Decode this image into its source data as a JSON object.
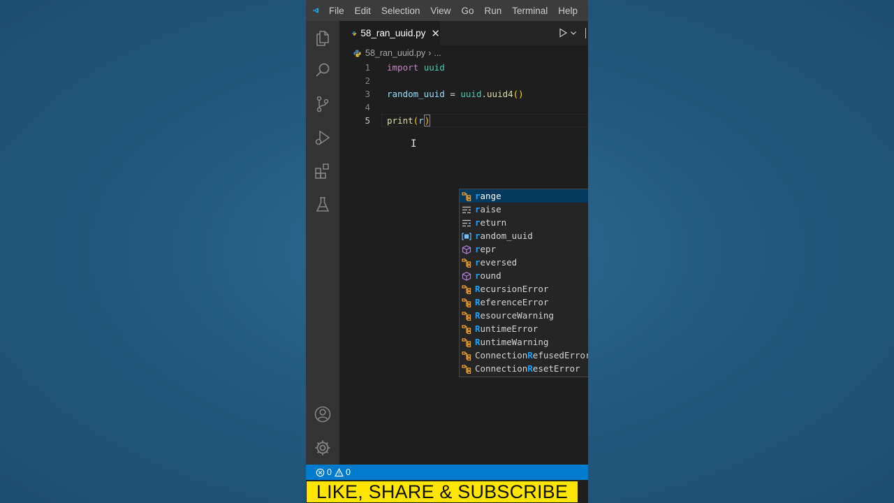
{
  "menu": [
    "File",
    "Edit",
    "Selection",
    "View",
    "Go",
    "Run",
    "Terminal",
    "Help"
  ],
  "tab": {
    "filename": "58_ran_uuid.py",
    "close": "✕"
  },
  "breadcrumb": {
    "file": "58_ran_uuid.py",
    "more": "..."
  },
  "editor": {
    "line_numbers": [
      "1",
      "2",
      "3",
      "4",
      "5"
    ],
    "line1": {
      "kw": "import",
      "mod": "uuid"
    },
    "line3": {
      "var": "random_uuid",
      "op": " = ",
      "mod": "uuid",
      "dot": ".",
      "fn": "uuid4",
      "args": "()"
    },
    "line5": {
      "fn": "print",
      "open": "(",
      "typed": "r",
      "close": ")"
    }
  },
  "suggestions": [
    {
      "kind": "class",
      "match": "r",
      "rest": "ange",
      "pre": ""
    },
    {
      "kind": "keyword",
      "match": "r",
      "rest": "aise",
      "pre": ""
    },
    {
      "kind": "keyword",
      "match": "r",
      "rest": "eturn",
      "pre": ""
    },
    {
      "kind": "variable",
      "match": "r",
      "rest": "andom_uuid",
      "pre": ""
    },
    {
      "kind": "function",
      "match": "r",
      "rest": "epr",
      "pre": ""
    },
    {
      "kind": "class",
      "match": "r",
      "rest": "eversed",
      "pre": ""
    },
    {
      "kind": "function",
      "match": "r",
      "rest": "ound",
      "pre": ""
    },
    {
      "kind": "class",
      "match": "R",
      "rest": "ecursionError",
      "pre": ""
    },
    {
      "kind": "class",
      "match": "R",
      "rest": "eferenceError",
      "pre": ""
    },
    {
      "kind": "class",
      "match": "R",
      "rest": "esourceWarning",
      "pre": ""
    },
    {
      "kind": "class",
      "match": "R",
      "rest": "untimeError",
      "pre": ""
    },
    {
      "kind": "class",
      "match": "R",
      "rest": "untimeWarning",
      "pre": ""
    },
    {
      "kind": "class",
      "match": "R",
      "rest": "efusedError",
      "pre": "Connection"
    },
    {
      "kind": "class",
      "match": "R",
      "rest": "esetError",
      "pre": "Connection"
    }
  ],
  "status": {
    "errors": "0",
    "warnings": "0"
  },
  "banner": "LIKE, SHARE & SUBSCRIBE",
  "colors": {
    "accent": "#007acc",
    "banner_bg": "#ffe600",
    "match_highlight": "#18a3ff",
    "selected_row": "#04395e",
    "class_icon": "#ee9d28",
    "function_icon": "#b180d7",
    "variable_icon": "#75beff"
  }
}
